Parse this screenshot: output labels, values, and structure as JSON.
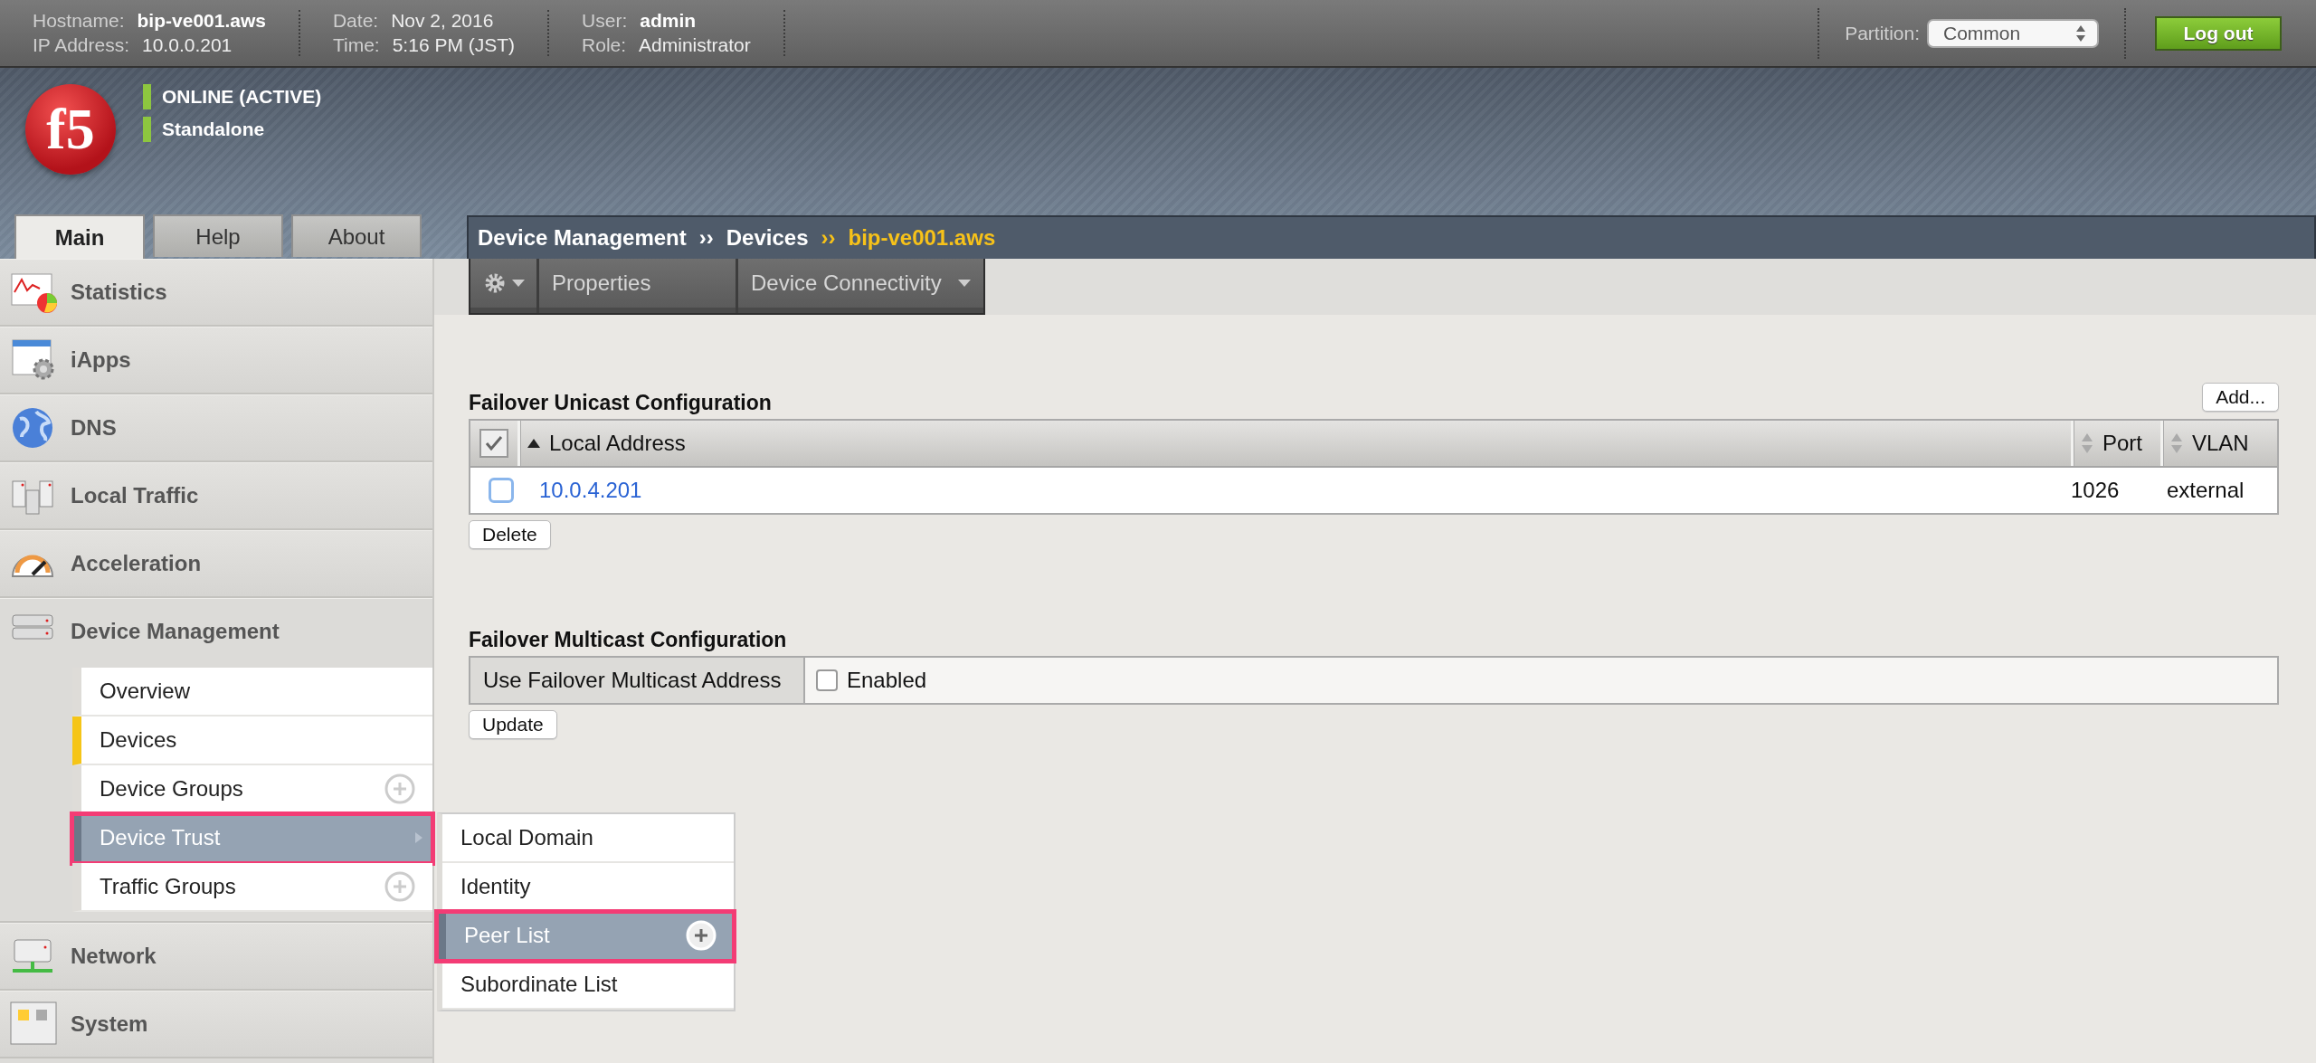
{
  "top_bar": {
    "info_groups": [
      {
        "rows": [
          {
            "label": "Hostname:",
            "value": "bip-ve001.aws",
            "bold": true
          },
          {
            "label": "IP Address:",
            "value": "10.0.0.201",
            "bold": false
          }
        ]
      },
      {
        "rows": [
          {
            "label": "Date:",
            "value": "Nov 2, 2016",
            "bold": false
          },
          {
            "label": "Time:",
            "value": "5:16 PM (JST)",
            "bold": false
          }
        ]
      },
      {
        "rows": [
          {
            "label": "User:",
            "value": "admin",
            "bold": true
          },
          {
            "label": "Role:",
            "value": "Administrator",
            "bold": false
          }
        ]
      }
    ],
    "partition": {
      "label": "Partition:",
      "value": "Common"
    },
    "logout_button": "Log out"
  },
  "banner": {
    "logo_text": "f5",
    "status": [
      "ONLINE (ACTIVE)",
      "Standalone"
    ]
  },
  "tabs": [
    {
      "label": "Main",
      "selected": true
    },
    {
      "label": "Help",
      "selected": false
    },
    {
      "label": "About",
      "selected": false
    }
  ],
  "sidebar": {
    "items": [
      {
        "label": "Statistics",
        "expanded": false
      },
      {
        "label": "iApps",
        "expanded": false
      },
      {
        "label": "DNS",
        "expanded": false
      },
      {
        "label": "Local Traffic",
        "expanded": false
      },
      {
        "label": "Acceleration",
        "expanded": false
      },
      {
        "label": "Device Management",
        "expanded": true,
        "children": [
          {
            "label": "Overview",
            "selected": false,
            "highlighted": false,
            "add_button": false,
            "submenu": false
          },
          {
            "label": "Devices",
            "selected": true,
            "highlighted": false,
            "add_button": false,
            "submenu": false
          },
          {
            "label": "Device Groups",
            "selected": false,
            "highlighted": false,
            "add_button": true,
            "submenu": false
          },
          {
            "label": "Device Trust",
            "selected": false,
            "highlighted": true,
            "add_button": false,
            "submenu": true,
            "flyout": [
              {
                "label": "Local Domain",
                "highlighted": false,
                "add_button": false
              },
              {
                "label": "Identity",
                "highlighted": false,
                "add_button": false
              },
              {
                "label": "Peer List",
                "highlighted": true,
                "add_button": true
              },
              {
                "label": "Subordinate List",
                "highlighted": false,
                "add_button": false
              }
            ]
          },
          {
            "label": "Traffic Groups",
            "selected": false,
            "highlighted": false,
            "add_button": true,
            "submenu": false
          }
        ]
      },
      {
        "label": "Network",
        "expanded": false
      },
      {
        "label": "System",
        "expanded": false
      }
    ]
  },
  "breadcrumb": [
    {
      "label": "Device Management",
      "selected": false
    },
    {
      "label": "Devices",
      "selected": false
    },
    {
      "label": "bip-ve001.aws",
      "selected": true
    }
  ],
  "breadcrumb_separator": "››",
  "toolbar": {
    "items": [
      {
        "label": "Properties",
        "dropdown": false
      },
      {
        "label": "Device Connectivity",
        "dropdown": true
      }
    ]
  },
  "unicast": {
    "title": "Failover Unicast Configuration",
    "add_button": "Add...",
    "columns": [
      {
        "label": "Local Address",
        "sorted_ascending": true
      },
      {
        "label": "Port",
        "sorted_ascending": false
      },
      {
        "label": "VLAN",
        "sorted_ascending": false
      }
    ],
    "select_all_checked": true,
    "rows": [
      {
        "checked": false,
        "address": "10.0.4.201",
        "port": "1026",
        "vlan": "external"
      }
    ],
    "delete_button": "Delete"
  },
  "multicast": {
    "title": "Failover Multicast Configuration",
    "field_label": "Use Failover Multicast Address",
    "checkbox_label": "Enabled",
    "checked": false,
    "update_button": "Update"
  }
}
